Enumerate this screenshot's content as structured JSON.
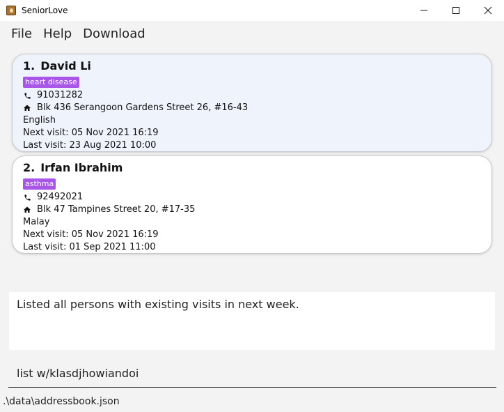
{
  "window": {
    "title": "SeniorLove"
  },
  "menu": {
    "items": [
      "File",
      "Help",
      "Download"
    ]
  },
  "persons": [
    {
      "index": "1.",
      "name": "David Li",
      "tag": "heart disease",
      "phone": "91031282",
      "address": "Blk 436 Serangoon Gardens Street 26, #16-43",
      "language": "English",
      "next_visit": "Next visit: 05 Nov 2021 16:19",
      "last_visit": "Last visit: 23 Aug 2021 10:00"
    },
    {
      "index": "2.",
      "name": "Irfan Ibrahim",
      "tag": "asthma",
      "phone": "92492021",
      "address": "Blk 47 Tampines Street 20, #17-35",
      "language": "Malay",
      "next_visit": "Next visit: 05 Nov 2021 16:19",
      "last_visit": "Last visit: 01 Sep 2021 11:00"
    }
  ],
  "result": {
    "message": "Listed all persons with existing visits in next week."
  },
  "command": {
    "value": "list w/klasdjhowiandoi"
  },
  "status": {
    "path": ".\\data\\addressbook.json"
  },
  "colors": {
    "tag": "#a855e8",
    "selected_card": "#eef3fc"
  }
}
